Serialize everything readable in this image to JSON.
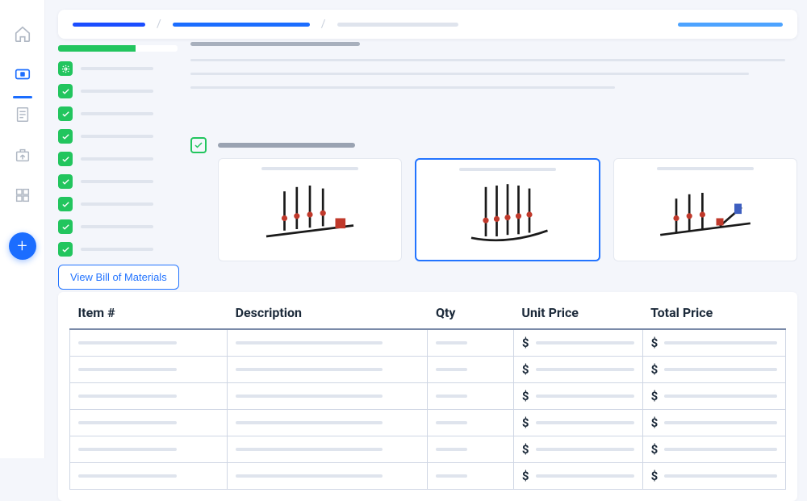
{
  "rail": {
    "items": [
      {
        "name": "home-icon"
      },
      {
        "name": "module-icon"
      },
      {
        "name": "document-icon"
      },
      {
        "name": "export-icon"
      },
      {
        "name": "apps-icon"
      }
    ],
    "active_index": 1,
    "add_label": "+"
  },
  "breadcrumb": {
    "sep": "/",
    "crumb1": "",
    "crumb2": "",
    "crumb3": "",
    "action": ""
  },
  "progress": {
    "pct": 65
  },
  "checklist": {
    "items": [
      {
        "icon": "gear",
        "label": ""
      },
      {
        "icon": "check",
        "label": ""
      },
      {
        "icon": "check",
        "label": ""
      },
      {
        "icon": "check",
        "label": ""
      },
      {
        "icon": "check",
        "label": ""
      },
      {
        "icon": "check",
        "label": ""
      },
      {
        "icon": "check",
        "label": ""
      },
      {
        "icon": "check",
        "label": ""
      },
      {
        "icon": "check",
        "label": ""
      }
    ],
    "indent_item": {
      "icon": "check",
      "label": ""
    }
  },
  "section": {
    "title": ""
  },
  "cards": {
    "selected_index": 1,
    "items": [
      {
        "title": ""
      },
      {
        "title": ""
      },
      {
        "title": ""
      }
    ]
  },
  "bom_button": "View Bill of Materials",
  "table": {
    "headers": {
      "item": "Item #",
      "desc": "Description",
      "qty": "Qty",
      "unit_price": "Unit Price",
      "total_price": "Total Price"
    },
    "currency_symbol": "$",
    "rows": [
      {
        "item": "",
        "desc": "",
        "qty": "",
        "unit": "",
        "total": ""
      },
      {
        "item": "",
        "desc": "",
        "qty": "",
        "unit": "",
        "total": ""
      },
      {
        "item": "",
        "desc": "",
        "qty": "",
        "unit": "",
        "total": ""
      },
      {
        "item": "",
        "desc": "",
        "qty": "",
        "unit": "",
        "total": ""
      },
      {
        "item": "",
        "desc": "",
        "qty": "",
        "unit": "",
        "total": ""
      },
      {
        "item": "",
        "desc": "",
        "qty": "",
        "unit": "",
        "total": ""
      }
    ]
  }
}
